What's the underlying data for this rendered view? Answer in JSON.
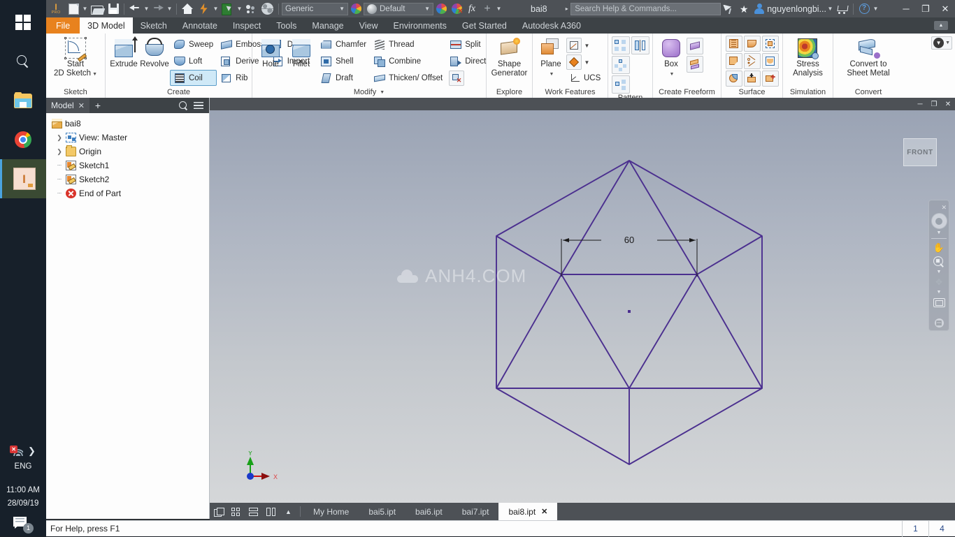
{
  "taskbar": {
    "items": [
      {
        "name": "start-button",
        "icon": "windows-logo-icon"
      },
      {
        "name": "search-button",
        "icon": "search-icon"
      },
      {
        "name": "file-explorer-button",
        "icon": "folder-icon"
      },
      {
        "name": "chrome-button",
        "icon": "chrome-icon"
      },
      {
        "name": "inventor-button",
        "icon": "inventor-app-icon"
      }
    ],
    "tray": {
      "language": "ENG",
      "time": "11:00 AM",
      "date": "28/09/19",
      "notification_count": "1",
      "network_status": "disconnected"
    }
  },
  "quick_access": {
    "logo_label": "I",
    "logo_sub": "PRO",
    "buttons": [
      {
        "name": "new-file-button",
        "icon": "new-document-icon"
      },
      {
        "name": "open-file-button",
        "icon": "open-folder-icon"
      },
      {
        "name": "save-button",
        "icon": "floppy-save-icon"
      },
      {
        "name": "undo-button",
        "icon": "undo-arrow-icon"
      },
      {
        "name": "redo-button",
        "icon": "redo-arrow-icon"
      },
      {
        "name": "home-button",
        "icon": "home-icon"
      },
      {
        "name": "update-button",
        "icon": "lightning-update-icon"
      },
      {
        "name": "return-button",
        "icon": "return-green-box-icon"
      },
      {
        "name": "select-button",
        "icon": "select-people-icon"
      },
      {
        "name": "appearance-globe-button",
        "icon": "globe-icon"
      }
    ],
    "material_value": "Generic",
    "appearance_value": "Default",
    "fx_label": "fx",
    "document_title": "bai8"
  },
  "title_bar": {
    "search_placeholder": "Search Help & Commands...",
    "user_name": "nguyenlongbi...",
    "window_buttons": [
      "minimize",
      "restore",
      "close"
    ]
  },
  "ribbon_tabs": [
    {
      "label": "File",
      "active": false,
      "style": "file"
    },
    {
      "label": "3D Model",
      "active": true
    },
    {
      "label": "Sketch",
      "active": false
    },
    {
      "label": "Annotate",
      "active": false
    },
    {
      "label": "Inspect",
      "active": false
    },
    {
      "label": "Tools",
      "active": false
    },
    {
      "label": "Manage",
      "active": false
    },
    {
      "label": "View",
      "active": false
    },
    {
      "label": "Environments",
      "active": false
    },
    {
      "label": "Get Started",
      "active": false
    },
    {
      "label": "Autodesk A360",
      "active": false
    }
  ],
  "ribbon_panels": {
    "sketch": {
      "title": "Sketch",
      "big_buttons": [
        {
          "label": "Start\n2D Sketch",
          "line1": "Start",
          "line2": "2D Sketch",
          "icon": "start-2d-sketch-icon"
        }
      ]
    },
    "create": {
      "title": "Create",
      "big_buttons": [
        {
          "label": "Extrude",
          "icon": "extrude-icon"
        },
        {
          "label": "Revolve",
          "icon": "revolve-icon"
        }
      ],
      "small_col1": [
        {
          "label": "Sweep",
          "icon": "sweep-icon",
          "selected": false
        },
        {
          "label": "Loft",
          "icon": "loft-icon",
          "selected": false
        },
        {
          "label": "Coil",
          "icon": "coil-icon",
          "selected": true
        }
      ],
      "small_col2": [
        {
          "label": "Emboss",
          "icon": "emboss-icon",
          "selected": false
        },
        {
          "label": "Derive",
          "icon": "derive-icon",
          "selected": false
        },
        {
          "label": "Rib",
          "icon": "rib-icon",
          "selected": false
        }
      ],
      "small_col3": [
        {
          "label": "Decal",
          "icon": "decal-icon",
          "selected": false
        },
        {
          "label": "Import",
          "icon": "import-icon",
          "selected": false
        }
      ]
    },
    "modify": {
      "title": "Modify",
      "big_buttons": [
        {
          "label": "Hole",
          "icon": "hole-icon"
        },
        {
          "label": "Fillet",
          "icon": "fillet-icon"
        }
      ],
      "small_col1": [
        {
          "label": "Chamfer",
          "icon": "chamfer-icon"
        },
        {
          "label": "Shell",
          "icon": "shell-icon"
        },
        {
          "label": "Draft",
          "icon": "draft-icon"
        }
      ],
      "small_col2": [
        {
          "label": "Thread",
          "icon": "thread-icon"
        },
        {
          "label": "Combine",
          "icon": "combine-icon"
        },
        {
          "label": "Thicken/ Offset",
          "icon": "thicken-offset-icon"
        }
      ],
      "small_col3": [
        {
          "label": "Split",
          "icon": "split-icon"
        },
        {
          "label": "Direct",
          "icon": "direct-edit-icon"
        }
      ],
      "extra_button": {
        "name": "delete-face-button",
        "icon": "delete-face-icon"
      }
    },
    "explore": {
      "title": "Explore",
      "big_buttons": [
        {
          "line1": "Shape",
          "line2": "Generator",
          "icon": "shape-generator-icon"
        }
      ]
    },
    "work_features": {
      "title": "Work Features",
      "big_buttons": [
        {
          "label": "Plane",
          "icon": "work-plane-icon"
        }
      ],
      "grid_buttons": [
        {
          "name": "work-axis-button",
          "icon": "work-axis-icon"
        },
        {
          "name": "work-point-button",
          "icon": "work-point-icon"
        }
      ],
      "ucs_label": "UCS"
    },
    "pattern": {
      "title": "Pattern",
      "grid_buttons": [
        {
          "name": "rectangular-pattern-button",
          "icon": "rectangular-pattern-icon"
        },
        {
          "name": "mirror-button",
          "icon": "mirror-icon"
        },
        {
          "name": "circular-pattern-button",
          "icon": "circular-pattern-icon"
        },
        {
          "name": "sketch-driven-pattern-button",
          "icon": "sketch-driven-pattern-icon"
        }
      ]
    },
    "create_freeform": {
      "title": "Create Freeform",
      "big_buttons": [
        {
          "label": "Box",
          "icon": "freeform-box-icon"
        }
      ],
      "grid_buttons": [
        {
          "name": "freeform-plane-button",
          "icon": "freeform-plane-icon"
        },
        {
          "name": "freeform-convert-button",
          "icon": "freeform-convert-icon"
        }
      ]
    },
    "surface": {
      "title": "Surface",
      "grid_buttons": [
        {
          "name": "stitch-button",
          "icon": "stitch-icon"
        },
        {
          "name": "sculpt-button",
          "icon": "sculpt-icon"
        },
        {
          "name": "patch-button",
          "icon": "patch-icon"
        },
        {
          "name": "trim-surface-button",
          "icon": "trim-surface-icon"
        },
        {
          "name": "delete-face-surface-button",
          "icon": "scissors-icon"
        },
        {
          "name": "replace-face-button",
          "icon": "replace-face-icon"
        },
        {
          "name": "ruled-surface-button",
          "icon": "ruled-surface-icon"
        },
        {
          "name": "extend-button",
          "icon": "extend-icon"
        },
        {
          "name": "boundary-patch-button",
          "icon": "boundary-patch-icon"
        }
      ]
    },
    "simulation": {
      "title": "Simulation",
      "big_buttons": [
        {
          "line1": "Stress",
          "line2": "Analysis",
          "icon": "stress-analysis-icon"
        }
      ]
    },
    "convert": {
      "title": "Convert",
      "big_buttons": [
        {
          "line1": "Convert to",
          "line2": "Sheet Metal",
          "icon": "convert-sheet-metal-icon"
        }
      ]
    }
  },
  "browser": {
    "tab_label": "Model",
    "tree": [
      {
        "label": "bai8",
        "indent": 0,
        "icon": "part-icon",
        "expander": ""
      },
      {
        "label": "View: Master",
        "indent": 1,
        "icon": "view-icon",
        "expander": "collapsed"
      },
      {
        "label": "Origin",
        "indent": 1,
        "icon": "folder-icon",
        "expander": "collapsed"
      },
      {
        "label": "Sketch1",
        "indent": 1,
        "icon": "sketch-icon",
        "expander": "leaf"
      },
      {
        "label": "Sketch2",
        "indent": 1,
        "icon": "sketch-icon",
        "expander": "leaf"
      },
      {
        "label": "End of Part",
        "indent": 1,
        "icon": "end-of-part-icon",
        "expander": "leaf"
      }
    ]
  },
  "viewport": {
    "watermark": "ANH4.COM",
    "viewcube_label": "FRONT",
    "dimension_label": "60",
    "axis_x": "X",
    "axis_y": "Y",
    "geometry_color": "#4b2f8f",
    "dimension_color": "#1a1a1a"
  },
  "doc_tabs": {
    "view_buttons": [
      {
        "name": "tile-view-button",
        "icon": "cascade-windows-icon"
      },
      {
        "name": "grid-view-button",
        "icon": "grid-windows-icon"
      },
      {
        "name": "horizontal-split-button",
        "icon": "horizontal-split-icon"
      },
      {
        "name": "vertical-split-button",
        "icon": "vertical-split-icon"
      },
      {
        "name": "expand-tabs-button",
        "icon": "chevron-up-icon"
      }
    ],
    "tabs": [
      {
        "label": "My Home",
        "active": false,
        "closable": false
      },
      {
        "label": "bai5.ipt",
        "active": false,
        "closable": false
      },
      {
        "label": "bai6.ipt",
        "active": false,
        "closable": false
      },
      {
        "label": "bai7.ipt",
        "active": false,
        "closable": false
      },
      {
        "label": "bai8.ipt",
        "active": true,
        "closable": true
      }
    ]
  },
  "status_bar": {
    "message": "For Help, press F1",
    "cells": [
      "1",
      "4"
    ]
  }
}
